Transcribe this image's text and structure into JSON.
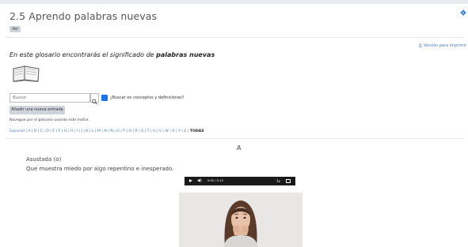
{
  "page": {
    "title": "2.5 Aprendo palabras nuevas",
    "badge": "Ver",
    "print_link": "Versión para imprimir",
    "intro_prefix": "En este glosario encontrarás el significado de ",
    "intro_bold": "palabras nuevas"
  },
  "search": {
    "placeholder": "Buscar",
    "checkbox_label": "¿Buscar en conceptos y definiciones?",
    "checkbox_checked": true
  },
  "actions": {
    "add_entry": "Añadir una nueva entrada"
  },
  "navigation": {
    "hint": "Navegue por el glosario usando este índice.",
    "alphabet": "Especial | A | B | C | D | E | F | G | H | I | J | K | L | M | N | Ñ | O | P | Q | R | S | T | U | V | W | X | Y | Z |",
    "all_label": "TODAS"
  },
  "entry": {
    "letter": "A",
    "term": "Asustada (o)",
    "definition": "Que muestra miedo por algo repentino e inesperado."
  },
  "player": {
    "time_label": "0:00 / 0:13"
  },
  "colors": {
    "accent": "#1a73e8",
    "link": "#4a7fc1",
    "player_bg": "#1a1a1a"
  }
}
